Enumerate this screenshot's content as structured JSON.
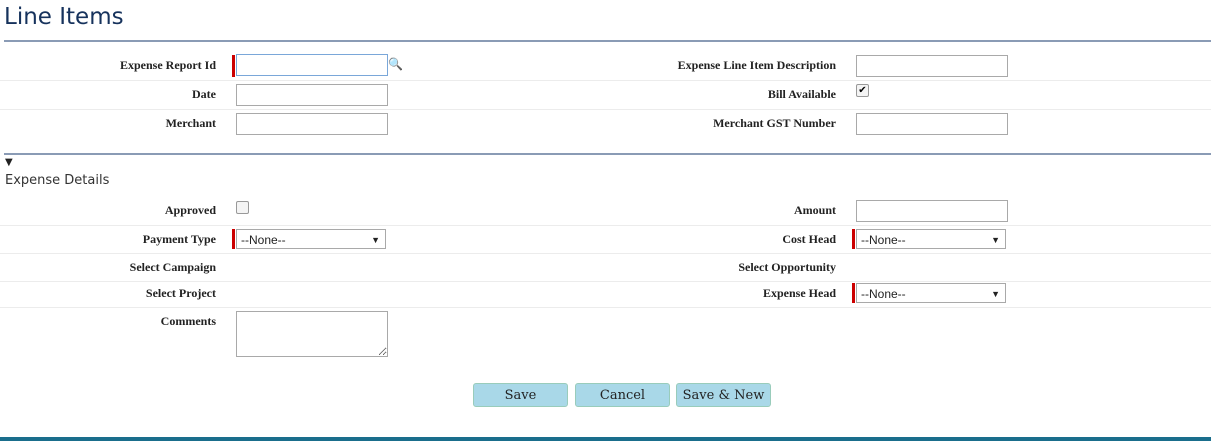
{
  "title": "Line Items",
  "fields": {
    "expense_report_id": "Expense Report Id",
    "expense_line_item_description": "Expense Line Item Description",
    "date": "Date",
    "bill_available": "Bill Available",
    "merchant": "Merchant",
    "merchant_gst_number": "Merchant GST Number"
  },
  "section": {
    "title": "Expense Details",
    "approved": "Approved",
    "amount": "Amount",
    "payment_type": "Payment Type",
    "cost_head": "Cost Head",
    "select_campaign": "Select Campaign",
    "select_opportunity": "Select Opportunity",
    "select_project": "Select Project",
    "expense_head": "Expense Head",
    "comments": "Comments"
  },
  "values": {
    "payment_type": "--None--",
    "cost_head": "--None--",
    "expense_head": "--None--",
    "bill_available_checked": true,
    "approved_checked": false
  },
  "buttons": {
    "save": "Save",
    "cancel": "Cancel",
    "save_new": "Save & New"
  },
  "colors": {
    "required": "#cc0000",
    "button": "#a9d8e8",
    "footer": "#1a6e8c"
  }
}
